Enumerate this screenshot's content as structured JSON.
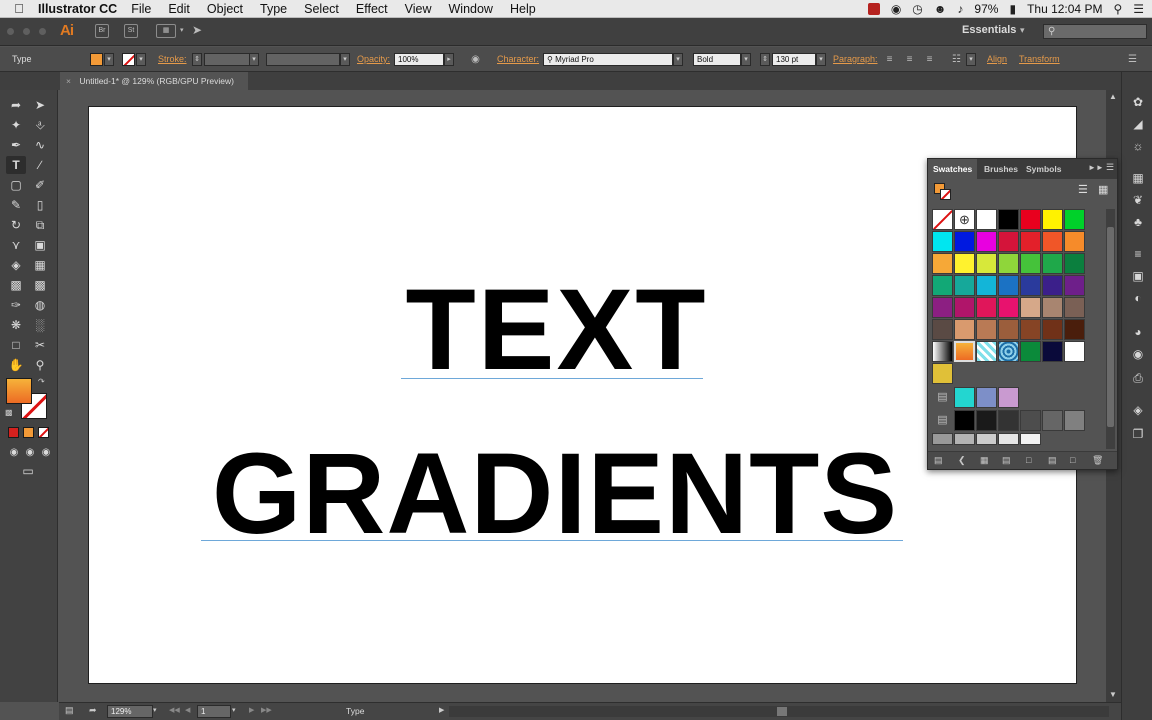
{
  "menubar": {
    "app_name": "Illustrator CC",
    "items": [
      "File",
      "Edit",
      "Object",
      "Type",
      "Select",
      "Effect",
      "View",
      "Window",
      "Help"
    ],
    "battery": "97%",
    "clock": "Thu 12:04 PM"
  },
  "appbar": {
    "logo": "Ai",
    "bridge": "Br",
    "stock": "St",
    "workspace": "Essentials",
    "search_placeholder": ""
  },
  "control_bar": {
    "tool_name": "Type",
    "stroke_label": "Stroke:",
    "opacity_label": "Opacity:",
    "opacity_value": "100%",
    "character_label": "Character:",
    "font_family": "Myriad Pro",
    "font_style": "Bold",
    "font_size": "130 pt",
    "paragraph_label": "Paragraph:",
    "align_label": "Align",
    "transform_label": "Transform"
  },
  "document_tab": {
    "title": "Untitled-1* @ 129% (RGB/GPU Preview)"
  },
  "artboard": {
    "line1": "TEXT",
    "line2": "GRADIENTS"
  },
  "swatches_panel": {
    "tabs": [
      "Swatches",
      "Brushes",
      "Symbols"
    ],
    "colors": {
      "accent_orange": "#f39a37",
      "stroke_none": "#d11111"
    }
  },
  "status_bar": {
    "zoom": "129%",
    "artboard_number": "1",
    "current_tool": "Type"
  }
}
